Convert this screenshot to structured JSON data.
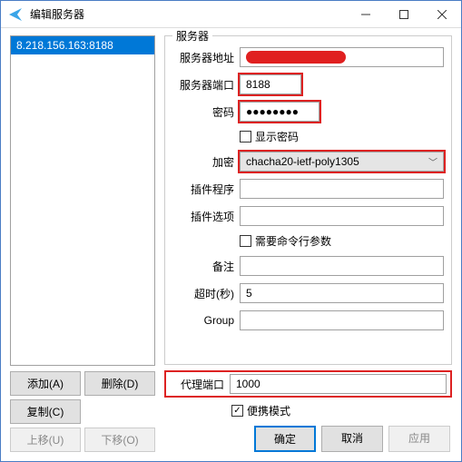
{
  "window": {
    "title": "编辑服务器"
  },
  "sidebar": {
    "items": [
      "8.218.156.163:8188"
    ],
    "buttons": {
      "add": "添加(A)",
      "delete": "删除(D)",
      "copy": "复制(C)",
      "move_up": "上移(U)",
      "move_down": "下移(O)"
    }
  },
  "form": {
    "group_title": "服务器",
    "server_addr_label": "服务器地址",
    "server_port_label": "服务器端口",
    "server_port": "8188",
    "password_label": "密码",
    "password_value": "●●●●●●●●",
    "show_password_label": "显示密码",
    "show_password_checked": false,
    "encryption_label": "加密",
    "encryption_value": "chacha20-ietf-poly1305",
    "plugin_program_label": "插件程序",
    "plugin_program": "",
    "plugin_options_label": "插件选项",
    "plugin_options": "",
    "need_cli_label": "需要命令行参数",
    "need_cli_checked": false,
    "remark_label": "备注",
    "remark": "",
    "timeout_label": "超时(秒)",
    "timeout": "5",
    "group_label": "Group",
    "group_value": ""
  },
  "proxy": {
    "port_label": "代理端口",
    "port": "1000",
    "portable_label": "便携模式",
    "portable_checked": true
  },
  "footer": {
    "ok": "确定",
    "cancel": "取消",
    "apply": "应用"
  }
}
